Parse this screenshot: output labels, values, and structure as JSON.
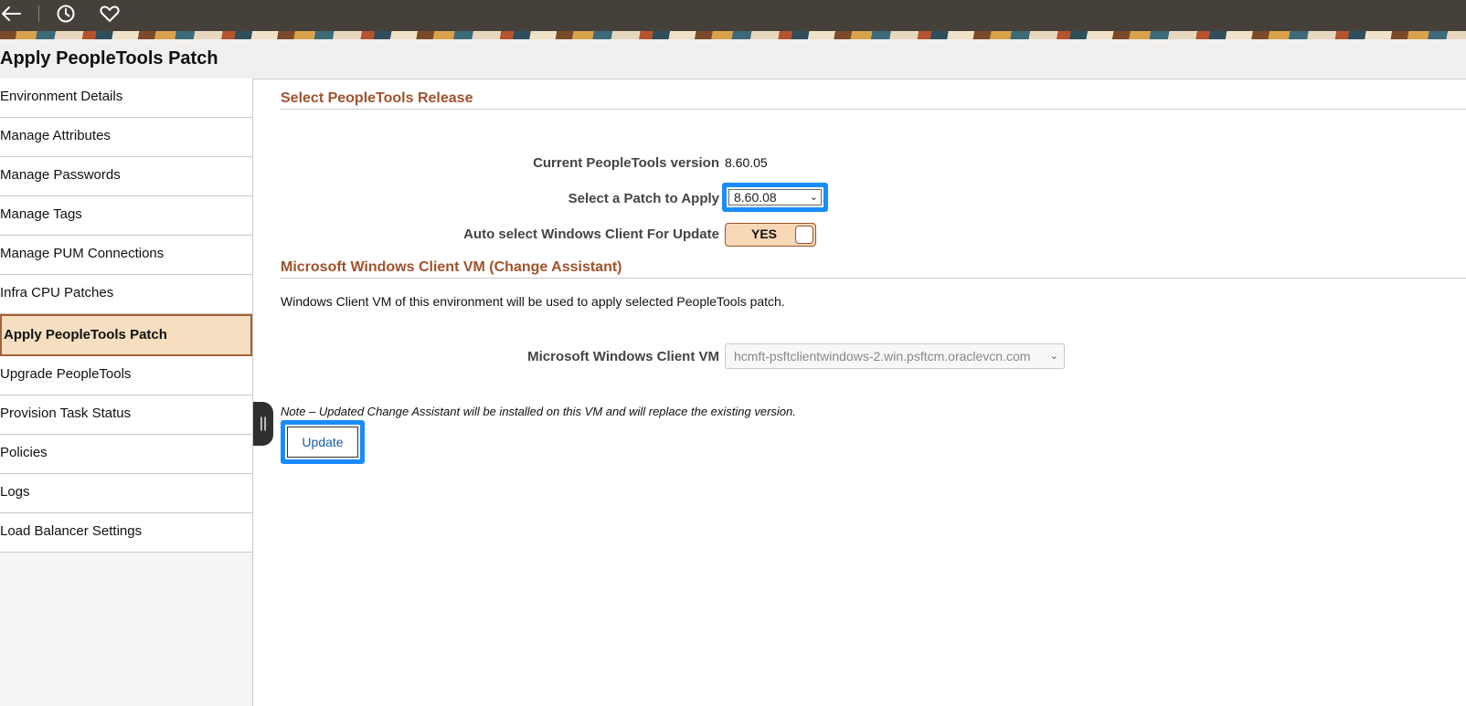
{
  "topbar": {
    "back_icon": "back-arrow-icon",
    "history_icon": "clock-icon",
    "favorites_icon": "heart-icon"
  },
  "page_title": "Apply PeopleTools Patch",
  "sidebar": {
    "items": [
      {
        "label": "Environment Details"
      },
      {
        "label": "Manage Attributes"
      },
      {
        "label": "Manage Passwords"
      },
      {
        "label": "Manage Tags"
      },
      {
        "label": "Manage PUM Connections"
      },
      {
        "label": "Infra CPU Patches"
      },
      {
        "label": "Apply PeopleTools Patch",
        "active": true
      },
      {
        "label": "Upgrade PeopleTools"
      },
      {
        "label": "Provision Task Status"
      },
      {
        "label": "Policies"
      },
      {
        "label": "Logs"
      },
      {
        "label": "Load Balancer Settings"
      }
    ],
    "collapse_handle_glyph": "||"
  },
  "main": {
    "release_section_title": "Select PeopleTools Release",
    "current_version_label": "Current PeopleTools version",
    "current_version_value": "8.60.05",
    "patch_label": "Select a Patch to Apply",
    "patch_selected": "8.60.08",
    "auto_select_label": "Auto select Windows Client For Update",
    "auto_select_toggle": "YES",
    "vm_section_title": "Microsoft Windows Client VM (Change Assistant)",
    "vm_description": "Windows Client VM of this environment will be used to apply selected PeopleTools patch.",
    "vm_label": "Microsoft Windows Client VM",
    "vm_selected": "hcmft-psftclientwindows-2.win.psftcm.oraclevcn.com",
    "note": "Note – Updated Change Assistant will be installed on this VM and will replace the existing version.",
    "update_button": "Update"
  },
  "colors": {
    "accent_blue": "#1a8cff",
    "section_title": "#a0522d",
    "active_nav_bg": "#f5dfc0",
    "topbar_bg": "#46403b"
  }
}
